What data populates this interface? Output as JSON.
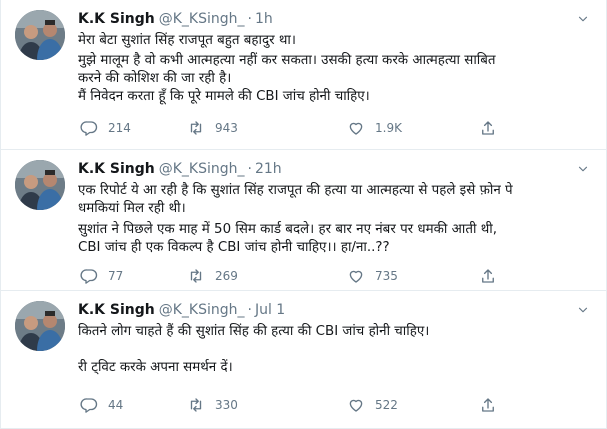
{
  "tweets": [
    {
      "name": "K.K Singh",
      "handle": "@K_KSingh_",
      "separator": "·",
      "time": "1h",
      "lines": [
        "मेरा बेटा सुशांत सिंह राजपूत बहुत बहादुर था।",
        "मुझे मालूम है वो कभी आत्महत्या नहीं कर सकता। उसकी हत्या करके आत्महत्या साबित",
        "करने की कोशिश की जा रही है।",
        "मैं निवेदन करता हूँ कि पूरे मामले की CBI जांच होनी चाहिए।"
      ],
      "replies": "214",
      "retweets": "943",
      "likes": "1.9K"
    },
    {
      "name": "K.K Singh",
      "handle": "@K_KSingh_",
      "separator": "·",
      "time": "21h",
      "lines": [
        "एक रिपोर्ट ये आ रही है कि सुशांत सिंह राजपूत की हत्या या आत्महत्या से पहले इसे फ़ोन पे",
        "धमकियां मिल रही थी।",
        "सुशांत ने पिछले एक माह में 50 सिम कार्ड बदले। हर बार नए नंबर पर धमकी आती थी,",
        "CBI जांच ही एक विकल्प है CBI जांच होनी चाहिए।। हा/ना..??"
      ],
      "replies": "77",
      "retweets": "269",
      "likes": "735"
    },
    {
      "name": "K.K Singh",
      "handle": "@K_KSingh_",
      "separator": "·",
      "time": "Jul 1",
      "lines": [
        "कितने लोग चाहते हैं की सुशांत सिंह की हत्या की CBI जांच होनी चाहिए।",
        "",
        "री ट्विट करके अपना समर्थन दें।"
      ],
      "replies": "44",
      "retweets": "330",
      "likes": "522"
    }
  ],
  "icons": {
    "reply": "reply-icon",
    "retweet": "retweet-icon",
    "like": "like-icon",
    "share": "share-icon",
    "more": "chevron-down-icon"
  },
  "colors": {
    "text": "#14171a",
    "muted": "#657786",
    "border": "#e6ecf0"
  }
}
